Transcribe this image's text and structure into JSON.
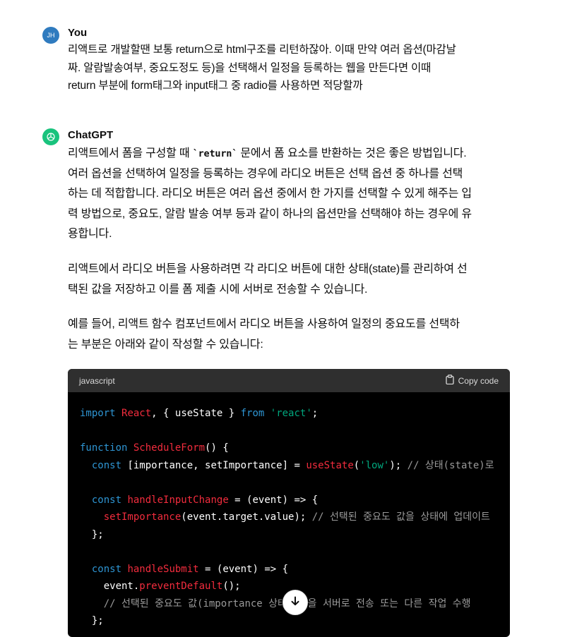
{
  "user_message": {
    "avatar_initials": "JH",
    "author": "You",
    "lines": [
      "리액트로 개발할땐 보통 return으로 html구조를 리턴하잖아. 이때 만약 여러 옵션(마감날",
      "짜. 알람발송여부, 중요도정도 등)을 선택해서 일정을 등록하는 웹을 만든다면 이때",
      "return 부분에 form태그와 input태그 중 radio를 사용하면 적당할까"
    ]
  },
  "assistant_message": {
    "author": "ChatGPT",
    "para1_prefix": "리액트에서 폼을 구성할 때 ",
    "para1_code": "`return`",
    "para1_suffix": " 문에서 폼 요소를 반환하는 것은 좋은 방법입니다.",
    "para1_lines": [
      "여러 옵션을 선택하여 일정을 등록하는 경우에 라디오 버튼은 선택 옵션 중 하나를 선택",
      "하는 데 적합합니다. 라디오 버튼은 여러 옵션 중에서 한 가지를 선택할 수 있게 해주는 입",
      "력 방법으로, 중요도, 알람 발송 여부 등과 같이 하나의 옵션만을 선택해야 하는 경우에 유",
      "용합니다."
    ],
    "para2_lines": [
      "리액트에서 라디오 버튼을 사용하려면 각 라디오 버튼에 대한 상태(state)를 관리하여 선",
      "택된 값을 저장하고 이를 폼 제출 시에 서버로 전송할 수 있습니다."
    ],
    "para3_lines": [
      "예를 들어, 리액트 함수 컴포넌트에서 라디오 버튼을 사용하여 일정의 중요도를 선택하",
      "는 부분은 아래와 같이 작성할 수 있습니다:"
    ]
  },
  "code_block": {
    "language": "javascript",
    "copy_label": "Copy code",
    "tokens": {
      "import": "import",
      "react_ident": "React",
      "import_mid": ", { useState } ",
      "from": "from",
      "react_str": "'react'",
      "semi": ";",
      "function": "function",
      "schedule_form": "ScheduleForm",
      "fn_tail": "() {",
      "const": "const",
      "state_decl": " [importance, setImportance] = ",
      "use_state": "useState",
      "low_arg": "'low'",
      "state_tail": "); ",
      "state_comment": "// 상태(state)로",
      "handle_input": "handleInputChange",
      "arrow_tail": " = (event) => {",
      "set_importance": "setImportance",
      "set_args": "(event.target.value); ",
      "set_comment": "// 선택된 중요도 값을 상태에 업데이트",
      "close_block": "};",
      "handle_submit": "handleSubmit",
      "event_obj": "event.",
      "prevent_default": "preventDefault",
      "prevent_tail": "();",
      "submit_comment": "// 선택된 중요도 값(importance 상태 값)을 서버로 전송 또는 다른 작업 수행"
    }
  },
  "icons": {
    "scroll_down": "arrow-down-icon",
    "copy": "clipboard-icon",
    "gpt_logo": "openai-logo-icon"
  }
}
